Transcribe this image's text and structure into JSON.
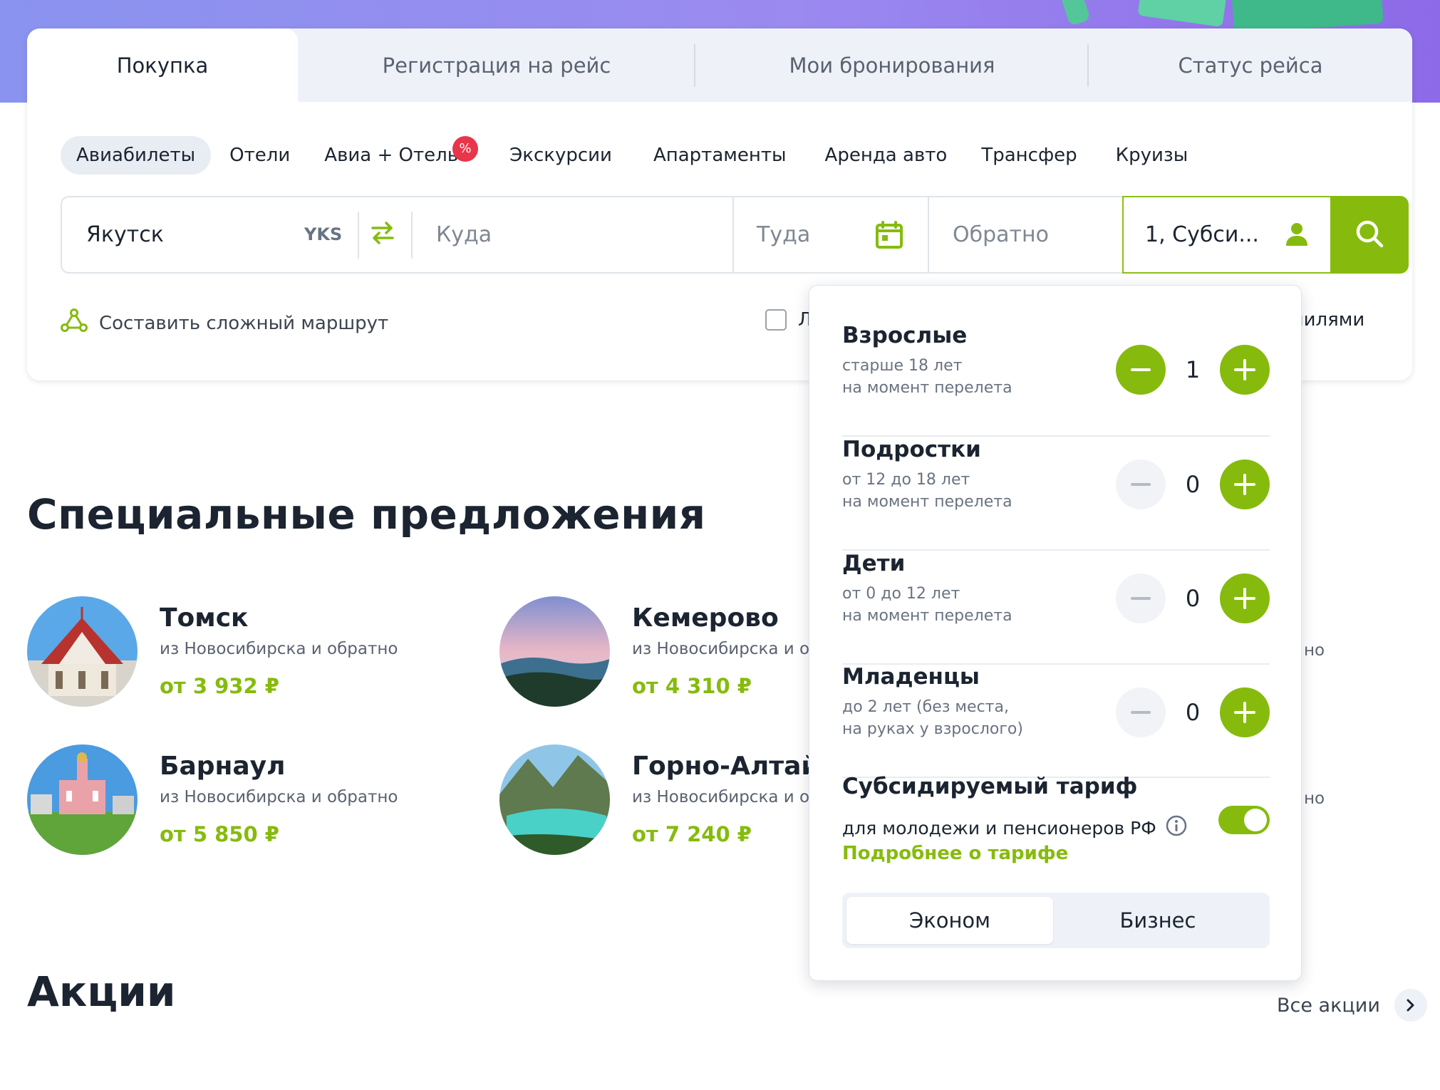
{
  "top_tabs": [
    "Покупка",
    "Регистрация на рейс",
    "Мои бронирования",
    "Статус рейса"
  ],
  "categories": [
    "Авиабилеты",
    "Отели",
    "Авиа + Отель",
    "Экскурсии",
    "Апартаменты",
    "Аренда авто",
    "Трансфер",
    "Круизы"
  ],
  "promo_badge": "%",
  "search": {
    "from_value": "Якутск",
    "from_code": "YKS",
    "to_placeholder": "Куда",
    "depart_placeholder": "Туда",
    "return_placeholder": "Обратно",
    "passengers_value": "1, Субси..."
  },
  "route_link": "Составить сложный маршрут",
  "checkbox_label_partial": "Л",
  "miles_label_partial": "милями",
  "special_offers": {
    "title": "Специальные предложения",
    "items": [
      {
        "city": "Томск",
        "sub": "из Новосибирска и обратно",
        "price": "от 3 932 ₽"
      },
      {
        "city": "Кемерово",
        "sub": "из Новосибирска и обр",
        "price": "от 4 310 ₽"
      },
      {
        "city": "Барнаул",
        "sub": "из Новосибирска и обратно",
        "price": "от 5 850 ₽"
      },
      {
        "city": "Горно-Алтайс",
        "sub": "из Новосибирска и обр",
        "price": "от 7 240 ₽"
      }
    ],
    "right_partial": [
      "но",
      "но"
    ]
  },
  "promos": {
    "title": "Акции",
    "all_link": "Все акции"
  },
  "passengers_popup": {
    "rows": [
      {
        "label": "Взрослые",
        "d1": "старше 18 лет",
        "d2": "на момент перелета",
        "count": "1"
      },
      {
        "label": "Подростки",
        "d1": "от 12 до 18 лет",
        "d2": "на момент перелета",
        "count": "0"
      },
      {
        "label": "Дети",
        "d1": "от 0 до 12 лет",
        "d2": "на момент перелета",
        "count": "0"
      },
      {
        "label": "Младенцы",
        "d1": "до 2 лет (без места,",
        "d2": "на руках у взрослого)",
        "count": "0"
      }
    ],
    "subsidized": {
      "title": "Субсидируемый тариф",
      "desc": "для молодежи и пенсионеров РФ",
      "more": "Подробнее о тарифе",
      "enabled": true
    },
    "class_options": [
      "Эконом",
      "Бизнес"
    ],
    "selected_class": "Эконом"
  },
  "colors": {
    "accent": "#86bb0d",
    "badge": "#e8354a",
    "text": "#1b2430"
  }
}
